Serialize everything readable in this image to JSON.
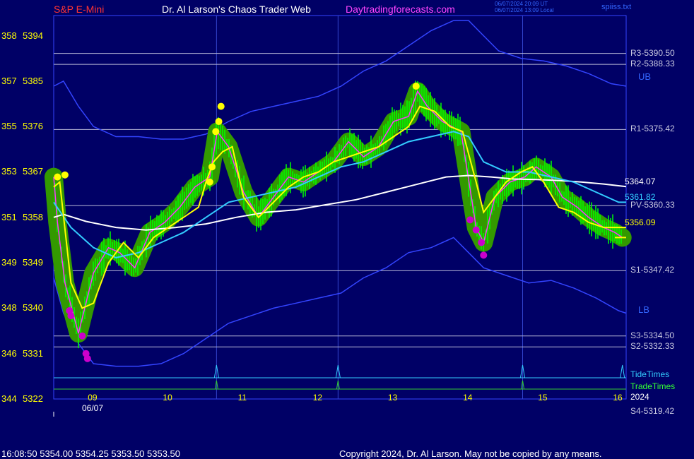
{
  "header": {
    "symbol": "S&P E-Mini",
    "site": "Dr. Al Larson's Chaos Trader Web",
    "url": "Daytradingforecasts.com",
    "timestamp_utc": "06/07/2024 20:09 UT",
    "timestamp_local": "06/07/2024 13:09 Local",
    "file": "spiiss.txt"
  },
  "footer": {
    "quote": "16:08:50  5354.00 5354.25 5353.50 5353.50",
    "copyright": "Copyright 2024, Dr. Al Larson. May not be copied by any means."
  },
  "colors": {
    "background": "#000066",
    "price": "#ff33ff",
    "bars": "#00ff00",
    "halo": "#339900",
    "fast_avg": "#ffff00",
    "mid_avg": "#33ccff",
    "slow_avg": "#ffffff",
    "bands": "#3344ff",
    "pivots": "#b8b8d8",
    "tide": "#33ccff",
    "trade": "#33cc33",
    "high_marker": "#ffff00",
    "low_marker": "#cc00cc"
  },
  "chart_data": {
    "type": "line",
    "x_axis": {
      "ticks": [
        "09",
        "10",
        "11",
        "12",
        "13",
        "14",
        "15",
        "16"
      ],
      "date_label": "06/07",
      "range": [
        8.47,
        16.1
      ]
    },
    "y_axis": {
      "ticks": [
        {
          "left": "358",
          "price": "5394"
        },
        {
          "left": "357",
          "price": "5385"
        },
        {
          "left": "355",
          "price": "5376"
        },
        {
          "left": "353",
          "price": "5367"
        },
        {
          "left": "351",
          "price": "5358"
        },
        {
          "left": "349",
          "price": "5349"
        },
        {
          "left": "348",
          "price": "5340"
        },
        {
          "left": "346",
          "price": "5331"
        },
        {
          "left": "344",
          "price": "5322"
        }
      ],
      "range": [
        5322,
        5398
      ]
    },
    "pivot_levels": [
      {
        "label": "R3-5390.50",
        "value": 5390.5
      },
      {
        "label": "R2-5388.33",
        "value": 5388.33
      },
      {
        "label": "R1-5375.42",
        "value": 5375.42
      },
      {
        "label": "PV-5360.33",
        "value": 5360.33
      },
      {
        "label": "S1-5347.42",
        "value": 5347.42
      },
      {
        "label": "S3-5334.50",
        "value": 5334.5
      },
      {
        "label": "S2-5332.33",
        "value": 5332.33
      },
      {
        "label": "S4-5319.42",
        "value": 5319.42
      }
    ],
    "band_labels": {
      "upper": "UB",
      "lower": "LB"
    },
    "last_values": [
      {
        "label": "5364.07",
        "series": "slow_avg"
      },
      {
        "label": "5361.82",
        "series": "mid_avg"
      },
      {
        "label": "5356.09",
        "series": "fast_avg"
      }
    ],
    "time_line_labels": {
      "tide": "TideTimes",
      "trade": "TradeTimes",
      "year": "2024"
    },
    "time_events": [
      10.64,
      12.26,
      14.72,
      16.05
    ],
    "session_lines": [
      10.64,
      12.26,
      14.72
    ],
    "series": [
      {
        "key": "price",
        "x": [
          8.47,
          8.52,
          8.62,
          8.8,
          9.0,
          9.2,
          9.35,
          9.55,
          9.75,
          9.95,
          10.15,
          10.35,
          10.55,
          10.65,
          10.8,
          11.0,
          11.2,
          11.4,
          11.6,
          11.8,
          12.0,
          12.2,
          12.4,
          12.6,
          12.8,
          13.0,
          13.2,
          13.32,
          13.45,
          13.65,
          13.9,
          14.1,
          14.2,
          14.35,
          14.55,
          14.75,
          14.9,
          15.1,
          15.25,
          15.45,
          15.6,
          15.8,
          15.95,
          16.05
        ],
        "y": [
          5366,
          5357,
          5345,
          5335,
          5347,
          5352,
          5351,
          5348,
          5355,
          5357,
          5360,
          5364,
          5366,
          5375,
          5372,
          5363,
          5358,
          5362,
          5366,
          5365,
          5367,
          5369,
          5373,
          5370,
          5372,
          5377,
          5378,
          5383,
          5380,
          5377,
          5375,
          5356,
          5353,
          5362,
          5365,
          5366,
          5368,
          5366,
          5362,
          5360,
          5358,
          5356,
          5355,
          5354
        ]
      },
      {
        "key": "fast_avg",
        "x": [
          8.47,
          8.55,
          8.7,
          8.85,
          9.0,
          9.2,
          9.4,
          9.6,
          9.8,
          10.0,
          10.2,
          10.4,
          10.5,
          10.6,
          10.72,
          10.85,
          11.0,
          11.2,
          11.4,
          11.6,
          11.8,
          12.0,
          12.2,
          12.4,
          12.6,
          12.8,
          13.0,
          13.2,
          13.35,
          13.55,
          13.75,
          13.92,
          14.1,
          14.2,
          14.3,
          14.5,
          14.7,
          14.85,
          15.0,
          15.2,
          15.4,
          15.6,
          15.8,
          15.95,
          16.1
        ],
        "y": [
          5364,
          5365,
          5345,
          5340,
          5341,
          5349,
          5353,
          5350,
          5354,
          5356,
          5358,
          5360,
          5365,
          5369,
          5371,
          5372,
          5362,
          5358,
          5361,
          5364,
          5366,
          5367,
          5369,
          5370,
          5371,
          5372,
          5374,
          5376,
          5380,
          5379,
          5376,
          5375,
          5365,
          5359,
          5361,
          5365,
          5367,
          5368,
          5365,
          5360,
          5359,
          5357,
          5356,
          5356,
          5356
        ]
      },
      {
        "key": "mid_avg",
        "x": [
          8.47,
          8.7,
          9.0,
          9.3,
          9.6,
          9.9,
          10.2,
          10.5,
          10.8,
          11.1,
          11.4,
          11.7,
          12.0,
          12.3,
          12.6,
          12.9,
          13.2,
          13.5,
          13.8,
          14.0,
          14.2,
          14.5,
          14.8,
          15.1,
          15.4,
          15.7,
          16.0,
          16.1
        ],
        "y": [
          5361,
          5356,
          5352,
          5350,
          5351,
          5353,
          5355,
          5358,
          5361,
          5362,
          5363,
          5364,
          5366,
          5368,
          5369,
          5371,
          5373,
          5374,
          5375,
          5374,
          5369,
          5367,
          5367,
          5366,
          5365,
          5363,
          5361,
          5361
        ]
      },
      {
        "key": "slow_avg",
        "x": [
          8.47,
          8.6,
          8.9,
          9.3,
          9.7,
          10.1,
          10.5,
          10.9,
          11.3,
          11.7,
          12.1,
          12.5,
          12.9,
          13.3,
          13.7,
          14.0,
          14.3,
          14.6,
          14.9,
          15.2,
          15.5,
          15.8,
          16.1
        ],
        "y": [
          5358,
          5358.6,
          5357.2,
          5356,
          5355.5,
          5356,
          5356.7,
          5358,
          5359,
          5359.5,
          5360.5,
          5361.5,
          5363,
          5364.5,
          5366,
          5366.3,
          5366,
          5365.6,
          5365.5,
          5365.3,
          5365,
          5364.6,
          5364.1
        ]
      },
      {
        "key": "upper_band",
        "x": [
          8.47,
          8.6,
          8.8,
          9.0,
          9.3,
          9.6,
          9.9,
          10.2,
          10.5,
          10.8,
          11.1,
          11.4,
          11.7,
          12.0,
          12.3,
          12.6,
          12.9,
          13.2,
          13.5,
          13.8,
          14.0,
          14.2,
          14.4,
          14.7,
          15.0,
          15.3,
          15.6,
          15.9,
          16.1
        ],
        "y": [
          5384,
          5385,
          5380,
          5376,
          5374,
          5374,
          5373.5,
          5373.5,
          5374.5,
          5377,
          5379,
          5380,
          5381,
          5382,
          5384,
          5387,
          5389,
          5392,
          5395,
          5397,
          5397,
          5394,
          5391,
          5389.5,
          5389,
          5388,
          5386.5,
          5384.5,
          5384
        ]
      },
      {
        "key": "lower_band",
        "x": [
          8.47,
          8.6,
          8.8,
          9.0,
          9.3,
          9.6,
          9.9,
          10.2,
          10.5,
          10.8,
          11.1,
          11.4,
          11.7,
          12.0,
          12.3,
          12.6,
          12.9,
          13.2,
          13.5,
          13.8,
          14.0,
          14.2,
          14.5,
          14.8,
          15.1,
          15.4,
          15.7,
          16.0,
          16.1
        ],
        "y": [
          5346,
          5339,
          5333,
          5329,
          5328.5,
          5328.5,
          5329,
          5331,
          5334,
          5337,
          5338.5,
          5340,
          5341,
          5342,
          5343,
          5346,
          5348,
          5351,
          5352,
          5354,
          5351,
          5348,
          5346.5,
          5345,
          5345.5,
          5344,
          5342,
          5339.5,
          5339
        ]
      }
    ],
    "high_markers": [
      [
        8.52,
        5366
      ],
      [
        8.62,
        5366.4
      ],
      [
        10.55,
        5365
      ],
      [
        10.58,
        5368
      ],
      [
        10.63,
        5375
      ],
      [
        10.67,
        5377
      ],
      [
        10.7,
        5380
      ],
      [
        13.3,
        5384
      ]
    ],
    "low_markers": [
      [
        8.68,
        5339.5
      ],
      [
        8.7,
        5338.5
      ],
      [
        8.85,
        5334.5
      ],
      [
        8.9,
        5331
      ],
      [
        8.92,
        5330
      ],
      [
        14.02,
        5357.5
      ],
      [
        14.1,
        5355.5
      ],
      [
        14.17,
        5353
      ],
      [
        14.2,
        5350.5
      ]
    ],
    "grid": false,
    "legend": "none"
  }
}
